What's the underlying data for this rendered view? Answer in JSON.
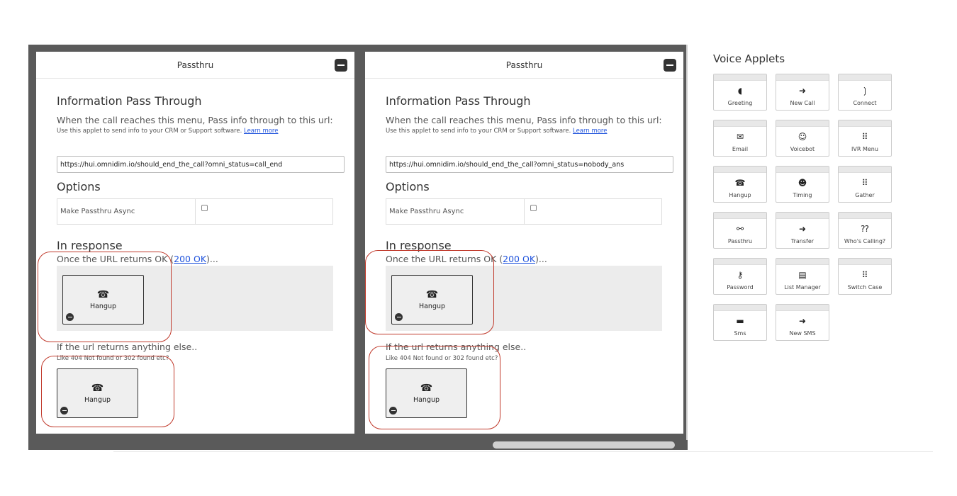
{
  "panels": [
    {
      "title": "Passthru",
      "heading": "Information Pass Through",
      "description": "When the call reaches this menu, Pass info through to this url:",
      "subdescription": "Use this applet to send info to your CRM or Support software.",
      "learn_more": "Learn more",
      "url_value": "https://hui.omnidim.io/should_end_the_call?omni_status=call_end",
      "options_heading": "Options",
      "option_label": "Make Passthru Async",
      "response_heading": "In response",
      "ok_prefix": "Once the URL returns OK (",
      "ok_link": "200 OK",
      "ok_suffix": ")...",
      "ok_applet": {
        "icon": "☎",
        "label": "Hangup"
      },
      "else_line": "If the url returns anything else..",
      "else_sub": "Like 404 Not found or 302 found etc?",
      "else_applet": {
        "icon": "☎",
        "label": "Hangup"
      }
    },
    {
      "title": "Passthru",
      "heading": "Information Pass Through",
      "description": "When the call reaches this menu, Pass info through to this url:",
      "subdescription": "Use this applet to send info to your CRM or Support software.",
      "learn_more": "Learn more",
      "url_value": "https://hui.omnidim.io/should_end_the_call?omni_status=nobody_ans",
      "options_heading": "Options",
      "option_label": "Make Passthru Async",
      "response_heading": "In response",
      "ok_prefix": "Once the URL returns OK (",
      "ok_link": "200 OK",
      "ok_suffix": ")...",
      "ok_applet": {
        "icon": "☎",
        "label": "Hangup"
      },
      "else_line": "If the url returns anything else..",
      "else_sub": "Like 404 Not found or 302 found etc?",
      "else_applet": {
        "icon": "☎",
        "label": "Hangup"
      }
    }
  ],
  "sidebar": {
    "title": "Voice Applets",
    "applets": [
      {
        "label": "Greeting",
        "icon": "◖",
        "icon_name": "greeting-icon"
      },
      {
        "label": "New Call",
        "icon": "➜",
        "icon_name": "new-call-icon"
      },
      {
        "label": "Connect",
        "icon": "❳",
        "icon_name": "connect-icon"
      },
      {
        "label": "Email",
        "icon": "✉",
        "icon_name": "email-icon"
      },
      {
        "label": "Voicebot",
        "icon": "☺",
        "icon_name": "voicebot-icon"
      },
      {
        "label": "IVR Menu",
        "icon": "⠿",
        "icon_name": "ivr-menu-icon"
      },
      {
        "label": "Hangup",
        "icon": "☎",
        "icon_name": "hangup-icon"
      },
      {
        "label": "Timing",
        "icon": "☻",
        "icon_name": "timing-icon"
      },
      {
        "label": "Gather",
        "icon": "⠿",
        "icon_name": "gather-icon"
      },
      {
        "label": "Passthru",
        "icon": "⚯",
        "icon_name": "passthru-icon"
      },
      {
        "label": "Transfer",
        "icon": "➜",
        "icon_name": "transfer-icon"
      },
      {
        "label": "Who's Calling?",
        "icon": "⁇",
        "icon_name": "whos-calling-icon"
      },
      {
        "label": "Password",
        "icon": "⚷",
        "icon_name": "password-icon"
      },
      {
        "label": "List Manager",
        "icon": "▤",
        "icon_name": "list-manager-icon"
      },
      {
        "label": "Switch Case",
        "icon": "⠿",
        "icon_name": "switch-case-icon"
      },
      {
        "label": "Sms",
        "icon": "▬",
        "icon_name": "sms-icon"
      },
      {
        "label": "New SMS",
        "icon": "➜",
        "icon_name": "new-sms-icon"
      }
    ]
  },
  "colors": {
    "canvas": "#5a5a5a",
    "annotation": "#c0392b",
    "link": "#2255dd"
  }
}
